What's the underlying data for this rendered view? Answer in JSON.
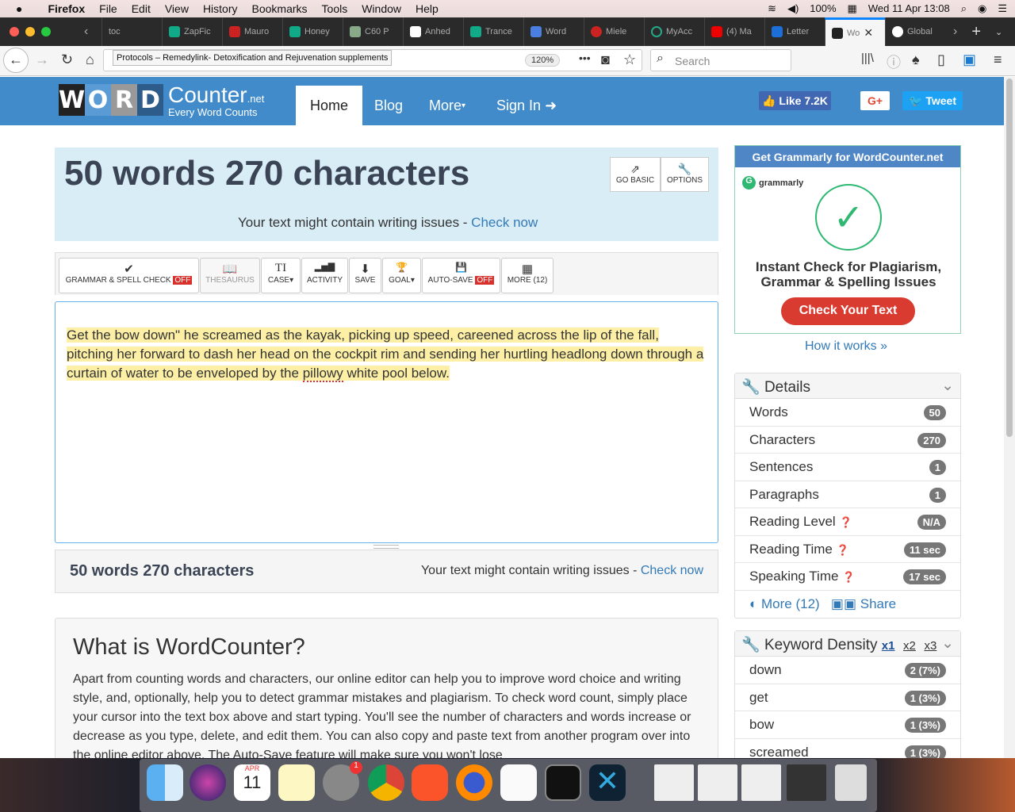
{
  "menubar": {
    "app": "Firefox",
    "items": [
      "File",
      "Edit",
      "View",
      "History",
      "Bookmarks",
      "Tools",
      "Window",
      "Help"
    ],
    "battery": "100%",
    "datetime": "Wed 11 Apr 13:08"
  },
  "tabs": [
    {
      "label": "toc"
    },
    {
      "label": "ZapFic"
    },
    {
      "label": "Mauro"
    },
    {
      "label": "Honey"
    },
    {
      "label": "C60 P"
    },
    {
      "label": "Anhed"
    },
    {
      "label": "Trance"
    },
    {
      "label": "Word"
    },
    {
      "label": "Miele"
    },
    {
      "label": "MyAcc"
    },
    {
      "label": "(4) Ma"
    },
    {
      "label": "Letter"
    },
    {
      "label": "Wo",
      "active": true
    },
    {
      "label": "Global"
    }
  ],
  "browser": {
    "tooltip": "Protocols – Remedylink- Detoxification and Rejuvenation supplements",
    "zoom": "120%",
    "search_placeholder": "Search"
  },
  "site": {
    "logo_letters": [
      "W",
      "O",
      "R",
      "D"
    ],
    "logo_name": "Counter",
    "logo_tld": ".net",
    "tagline": "Every Word Counts",
    "nav": [
      "Home",
      "Blog",
      "More",
      "Sign In"
    ],
    "like": "Like 7.2K",
    "gplus": "G+",
    "tweet": "Tweet"
  },
  "hero": {
    "title": "50 words 270 characters",
    "issues": "Your text might contain writing issues - ",
    "check": "Check now",
    "go_basic": "GO BASIC",
    "options": "OPTIONS"
  },
  "toolbar": [
    {
      "label": "GRAMMAR & SPELL CHECK",
      "icon": "✔",
      "badge": "OFF"
    },
    {
      "label": "THESAURUS",
      "icon": "📖"
    },
    {
      "label": "CASE",
      "icon": "TI"
    },
    {
      "label": "ACTIVITY",
      "icon": "▂▅▇"
    },
    {
      "label": "SAVE",
      "icon": "⬇"
    },
    {
      "label": "GOAL",
      "icon": "🏆"
    },
    {
      "label": "AUTO-SAVE",
      "icon": "💾",
      "badge": "OFF"
    },
    {
      "label": "MORE (12)",
      "icon": "▦"
    }
  ],
  "editor": {
    "text1": "Get the bow down\" he screamed as the kayak, picking up speed, careened across the lip of the fall, pitching her forward to dash her head on the cockpit rim and sending her hurtling headlong down through a curtain of water to be enveloped by the ",
    "misspelled": "pillowy",
    "text2": " white pool below."
  },
  "status": {
    "count": "50 words 270 characters",
    "issues": "Your text might contain writing issues - ",
    "check": "Check now"
  },
  "about": {
    "title": "What is WordCounter?",
    "body": "Apart from counting words and characters, our online editor can help you to improve word choice and writing style, and, optionally, help you to detect grammar mistakes and plagiarism. To check word count, simply place your cursor into the text box above and start typing. You'll see the number of characters and words increase or decrease as you type, delete, and edit them. You can also copy and paste text from another program over into the online editor above. The Auto-Save feature will make sure you won't lose"
  },
  "ad": {
    "header": "Get Grammarly for WordCounter.net",
    "brand": "grammarly",
    "headline": "Instant Check for Plagiarism, Grammar & Spelling Issues",
    "cta": "Check Your Text",
    "how": "How it works »",
    "accent": "#2eb872"
  },
  "details": {
    "title": "Details",
    "rows": [
      {
        "label": "Words",
        "value": "50"
      },
      {
        "label": "Characters",
        "value": "270"
      },
      {
        "label": "Sentences",
        "value": "1"
      },
      {
        "label": "Paragraphs",
        "value": "1"
      },
      {
        "label": "Reading Level",
        "value": "N/A",
        "help": true
      },
      {
        "label": "Reading Time",
        "value": "11 sec",
        "help": true
      },
      {
        "label": "Speaking Time",
        "value": "17 sec",
        "help": true
      }
    ],
    "more": "More (12)",
    "share": "Share"
  },
  "keywords": {
    "title": "Keyword Density",
    "x1": "x1",
    "x2": "x2",
    "x3": "x3",
    "rows": [
      {
        "label": "down",
        "value": "2 (7%)"
      },
      {
        "label": "get",
        "value": "1 (3%)"
      },
      {
        "label": "bow",
        "value": "1 (3%)"
      },
      {
        "label": "screamed",
        "value": "1 (3%)"
      }
    ]
  },
  "dock": {
    "calendar_month": "APR",
    "calendar_day": "11",
    "sysprefs_badge": "1"
  }
}
